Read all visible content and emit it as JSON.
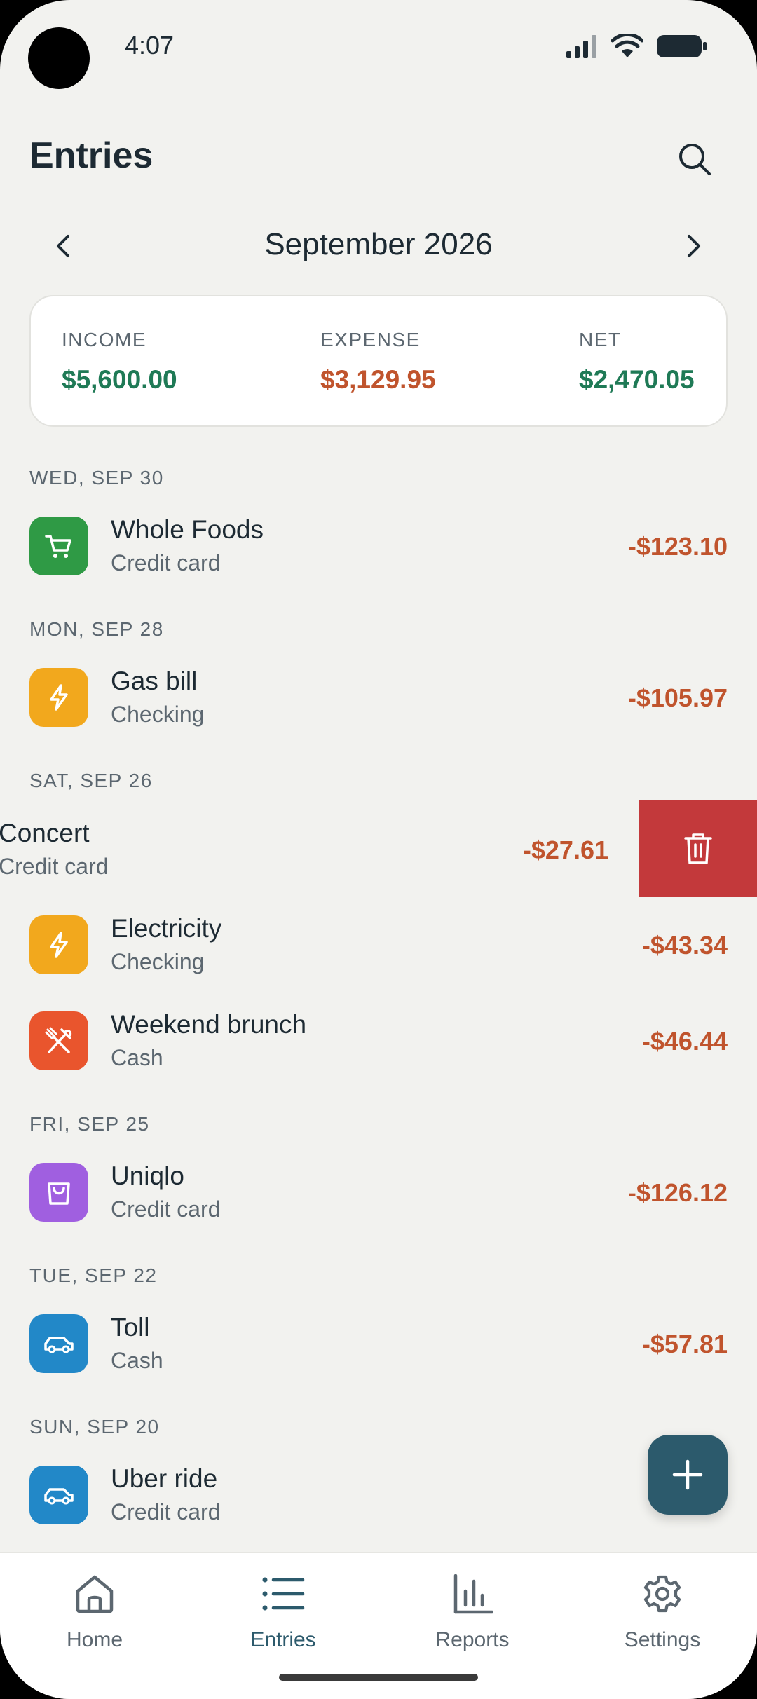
{
  "status_bar": {
    "time": "4:07"
  },
  "header": {
    "title": "Entries"
  },
  "month_nav": {
    "label": "September 2026"
  },
  "summary": {
    "income_label": "INCOME",
    "income_value": "$5,600.00",
    "expense_label": "EXPENSE",
    "expense_value": "$3,129.95",
    "net_label": "NET",
    "net_value": "$2,470.05"
  },
  "groups": [
    {
      "date": "WED, SEP 30",
      "entries": [
        {
          "title": "Whole Foods",
          "account": "Credit card",
          "amount": "-$123.10",
          "icon": "cart-icon",
          "color": "#2f9a45"
        }
      ]
    },
    {
      "date": "MON, SEP 28",
      "entries": [
        {
          "title": "Gas bill",
          "account": "Checking",
          "amount": "-$105.97",
          "icon": "bolt-icon",
          "color": "#f2a81d"
        }
      ]
    },
    {
      "date": "SAT, SEP 26",
      "entries": [
        {
          "title": "Concert",
          "account": "Credit card",
          "amount": "-$27.61",
          "icon": "ticket-icon",
          "color": "#c3393b",
          "swiped": true
        },
        {
          "title": "Electricity",
          "account": "Checking",
          "amount": "-$43.34",
          "icon": "bolt-icon",
          "color": "#f2a81d"
        },
        {
          "title": "Weekend brunch",
          "account": "Cash",
          "amount": "-$46.44",
          "icon": "utensils-icon",
          "color": "#e9552d"
        }
      ]
    },
    {
      "date": "FRI, SEP 25",
      "entries": [
        {
          "title": "Uniqlo",
          "account": "Credit card",
          "amount": "-$126.12",
          "icon": "shopping-bag-icon",
          "color": "#a05fe0"
        }
      ]
    },
    {
      "date": "TUE, SEP 22",
      "entries": [
        {
          "title": "Toll",
          "account": "Cash",
          "amount": "-$57.81",
          "icon": "car-icon",
          "color": "#2288c8"
        }
      ]
    },
    {
      "date": "SUN, SEP 20",
      "entries": [
        {
          "title": "Uber ride",
          "account": "Credit card",
          "amount": "-$",
          "icon": "car-icon",
          "color": "#2288c8"
        }
      ]
    }
  ],
  "colors": {
    "accent": "#2c5a6c",
    "income": "#1f7a56",
    "expense": "#c0542d",
    "delete": "#c3393b"
  },
  "bottom_nav": [
    {
      "label": "Home",
      "icon": "home-icon"
    },
    {
      "label": "Entries",
      "icon": "list-icon",
      "active": true
    },
    {
      "label": "Reports",
      "icon": "bar-chart-icon"
    },
    {
      "label": "Settings",
      "icon": "gear-icon"
    }
  ]
}
